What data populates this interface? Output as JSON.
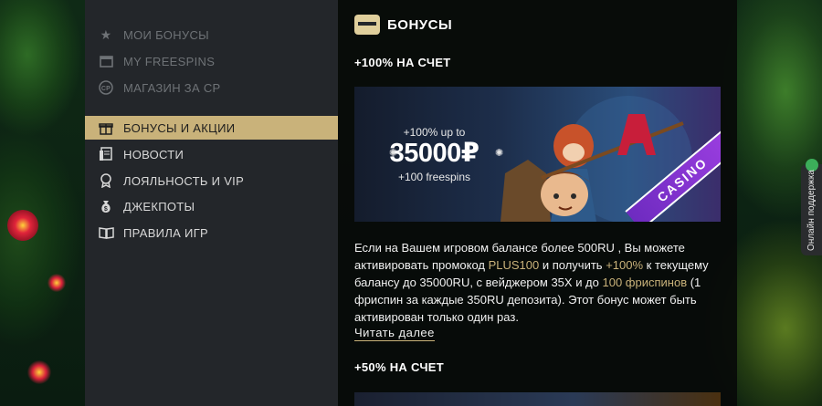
{
  "sidebar": {
    "items": [
      {
        "label": "МОИ БОНУСЫ",
        "icon": "star-icon",
        "state": "dim"
      },
      {
        "label": "MY FREESPINS",
        "icon": "calendar-icon",
        "state": "dim"
      },
      {
        "label": "МАГАЗИН ЗА CP",
        "icon": "cp-coin-icon",
        "state": "dim"
      },
      {
        "label": "БОНУСЫ И АКЦИИ",
        "icon": "gift-icon",
        "state": "active"
      },
      {
        "label": "НОВОСТИ",
        "icon": "news-icon",
        "state": "normal"
      },
      {
        "label": "ЛОЯЛЬНОСТЬ И VIP",
        "icon": "medal-icon",
        "state": "normal"
      },
      {
        "label": "ДЖЕКПОТЫ",
        "icon": "money-bag-icon",
        "state": "normal"
      },
      {
        "label": "ПРАВИЛА ИГР",
        "icon": "book-icon",
        "state": "normal"
      }
    ]
  },
  "content": {
    "title": "БОНУСЫ",
    "section1_title": "+100% НА СЧЕТ",
    "banner": {
      "line1": "+100% up to",
      "amount": "35000₽",
      "line3": "+100 freespins",
      "ribbon": "CASINO"
    },
    "description": {
      "p1": "Если на Вашем игровом балансе более 500RU , Вы можете активировать промокод ",
      "promo": "PLUS100",
      "p2": " и получить ",
      "percent": "+100%",
      "p3": " к текущему балансу до 35000RU, с вейджером 35X и до ",
      "freespins": "100 фриспинов",
      "p4": " (1 фриспин за каждые 350RU депозита). Этот бонус может быть активирован только один раз."
    },
    "read_more": "Читать далее",
    "section2_title": "+50% НА СЧЕТ"
  },
  "support": {
    "label": "Онлайн поддержка"
  },
  "colors": {
    "accent": "#c9b27a",
    "sidebar": "#23262a",
    "ribbon": "#8a35d4"
  }
}
